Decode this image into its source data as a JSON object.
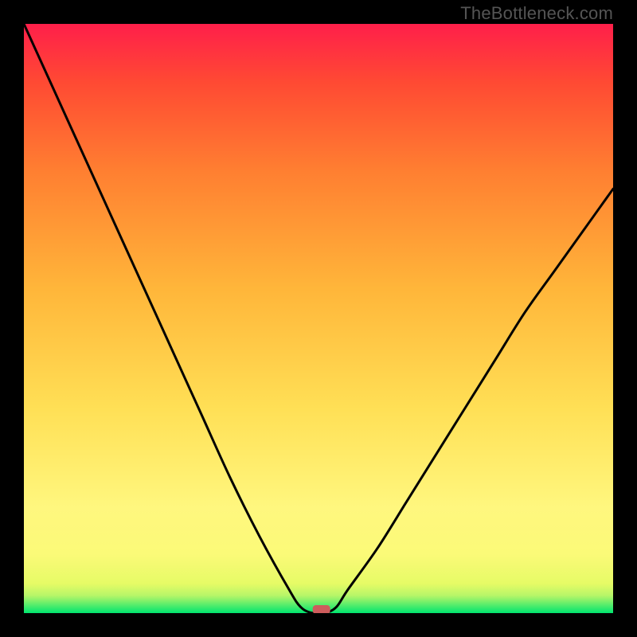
{
  "watermark": "TheBottleneck.com",
  "chart_data": {
    "type": "line",
    "title": "",
    "xlabel": "",
    "ylabel": "",
    "xlim": [
      0,
      100
    ],
    "ylim": [
      0,
      100
    ],
    "series": [
      {
        "name": "bottleneck-curve",
        "x": [
          0,
          5,
          10,
          15,
          20,
          25,
          30,
          35,
          40,
          45,
          47,
          49,
          51,
          53,
          55,
          60,
          65,
          70,
          75,
          80,
          85,
          90,
          95,
          100
        ],
        "y": [
          100,
          89,
          78,
          67,
          56,
          45,
          34,
          23,
          13,
          4,
          1,
          0,
          0,
          1,
          4,
          11,
          19,
          27,
          35,
          43,
          51,
          58,
          65,
          72
        ]
      }
    ],
    "marker": {
      "x": 50.5,
      "y": 0.6,
      "color": "#cd5c5c"
    },
    "gradient_stops": [
      {
        "offset": 0.0,
        "color": "#00e56f"
      },
      {
        "offset": 0.02,
        "color": "#7cf06a"
      },
      {
        "offset": 0.03,
        "color": "#b7f668"
      },
      {
        "offset": 0.05,
        "color": "#e6fb66"
      },
      {
        "offset": 0.1,
        "color": "#fbfa78"
      },
      {
        "offset": 0.18,
        "color": "#fff77e"
      },
      {
        "offset": 0.35,
        "color": "#ffdf55"
      },
      {
        "offset": 0.55,
        "color": "#ffb63a"
      },
      {
        "offset": 0.75,
        "color": "#ff7f31"
      },
      {
        "offset": 0.9,
        "color": "#ff4a33"
      },
      {
        "offset": 1.0,
        "color": "#ff1f4a"
      }
    ]
  }
}
